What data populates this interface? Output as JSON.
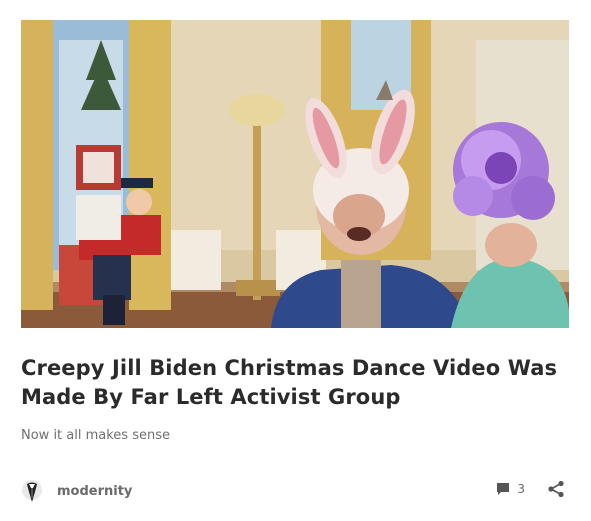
{
  "post": {
    "title": "Creepy Jill Biden Christmas Dance Video Was Made By Far Left Activist Group",
    "excerpt": "Now it all makes sense",
    "image_icon": "featured-image",
    "author": {
      "name": "modernity",
      "avatar_icon": "author-avatar-icon"
    },
    "comments": {
      "count": "3",
      "icon": "comment-icon"
    },
    "share_icon": "share-icon"
  }
}
